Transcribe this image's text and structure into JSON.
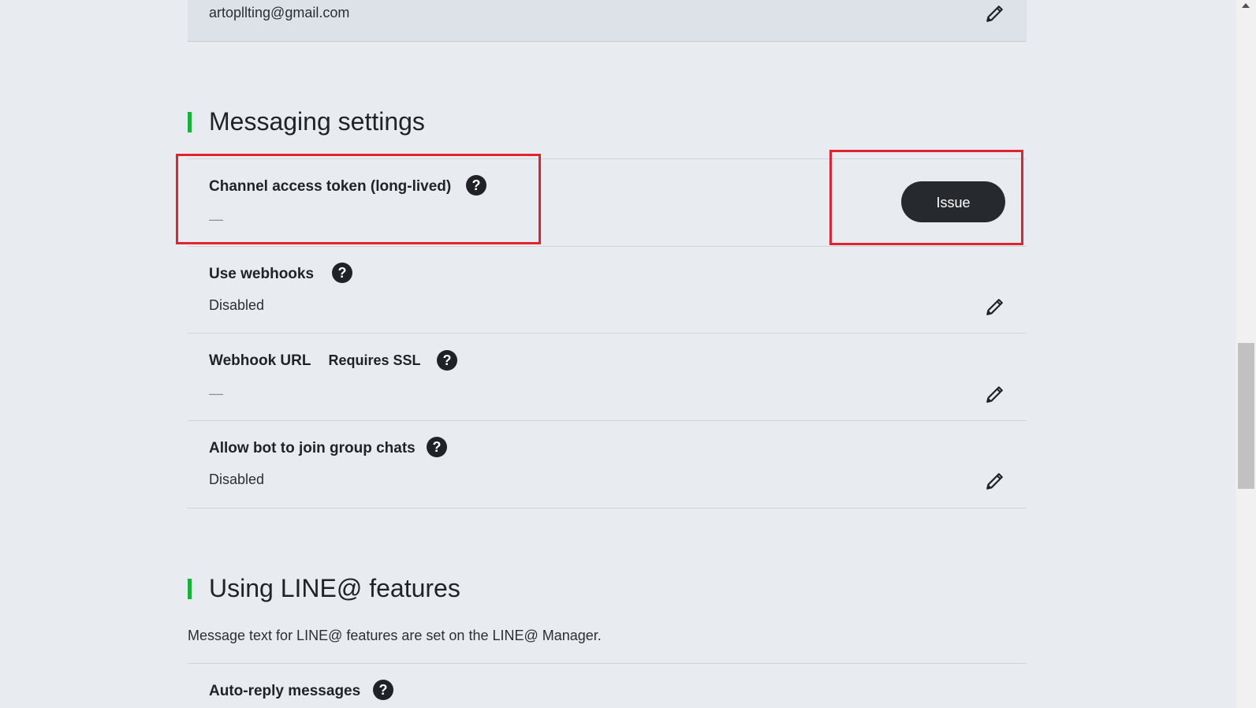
{
  "account": {
    "email": "artopllting@gmail.com"
  },
  "messaging_settings": {
    "title": "Messaging settings",
    "rows": [
      {
        "label": "Channel access token (long-lived)",
        "value": "—",
        "action_label": "Issue"
      },
      {
        "label": "Use webhooks",
        "value": "Disabled"
      },
      {
        "label": "Webhook URL",
        "extra": "Requires SSL",
        "value": "—"
      },
      {
        "label": "Allow bot to join group chats",
        "value": "Disabled"
      }
    ]
  },
  "line_features": {
    "title": "Using LINE@ features",
    "description": "Message text for LINE@ features are set on the LINE@ Manager.",
    "rows": [
      {
        "label": "Auto-reply messages"
      }
    ]
  },
  "help_glyph": "?",
  "icons": {
    "edit": "pencil-icon",
    "help": "question-circle-icon"
  },
  "colors": {
    "accent": "#12b538",
    "highlight": "#e0232e",
    "button": "#262a2f"
  }
}
